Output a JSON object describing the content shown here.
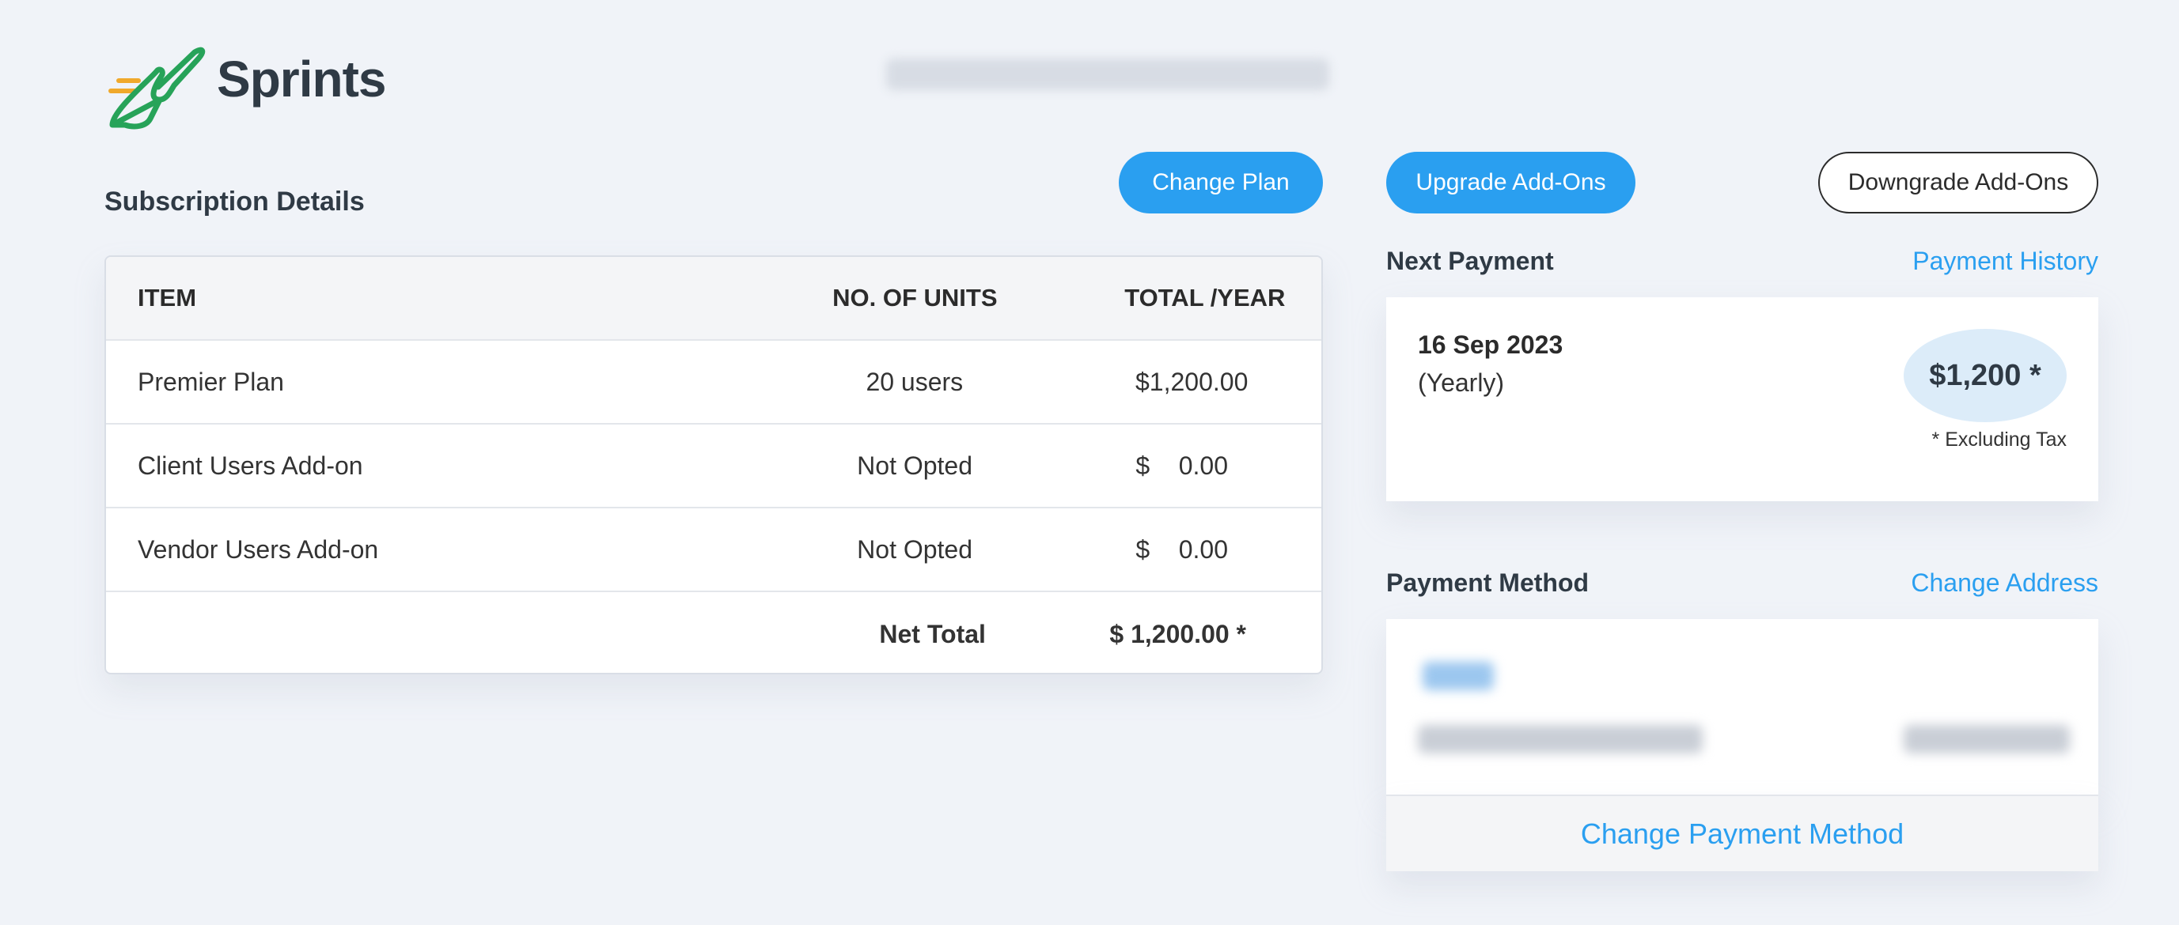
{
  "brand": {
    "name": "Sprints"
  },
  "colors": {
    "accent": "#2a9ff0",
    "logo_green": "#27a359",
    "logo_orange": "#f0a92b"
  },
  "subscription": {
    "title": "Subscription Details",
    "buttons": {
      "change_plan": "Change Plan",
      "upgrade_addons": "Upgrade Add-Ons",
      "downgrade_addons": "Downgrade Add-Ons"
    },
    "table": {
      "headers": {
        "item": "ITEM",
        "units": "NO. OF UNITS",
        "total": "TOTAL /YEAR"
      },
      "rows": [
        {
          "item": "Premier Plan",
          "units": "20 users",
          "currency": "$",
          "amount": "1,200.00"
        },
        {
          "item": "Client Users Add-on",
          "units": "Not Opted",
          "currency": "$",
          "amount": "0.00"
        },
        {
          "item": "Vendor Users Add-on",
          "units": "Not Opted",
          "currency": "$",
          "amount": "0.00"
        }
      ],
      "net_total_label": "Net Total",
      "net_total_value": "$ 1,200.00 *"
    }
  },
  "next_payment": {
    "title": "Next Payment",
    "history_link": "Payment History",
    "date": "16 Sep 2023",
    "cycle": "(Yearly)",
    "amount": "$1,200 *",
    "tax_note": "* Excluding Tax"
  },
  "payment_method": {
    "title": "Payment Method",
    "change_address_link": "Change Address",
    "change_method_link": "Change Payment Method"
  }
}
